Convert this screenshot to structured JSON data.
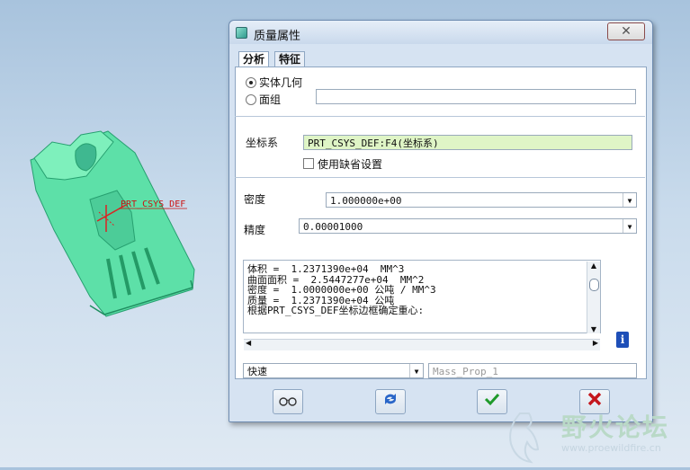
{
  "window": {
    "title": "质量属性",
    "close_symbol": "✕"
  },
  "tabs": [
    {
      "label": "分析"
    },
    {
      "label": "特征"
    }
  ],
  "model": {
    "csys_label": "PRT_CSYS_DEF"
  },
  "geometry": {
    "solid_label": "实体几何",
    "quilt_label": "面组",
    "quilt_value": "",
    "selected": "solid"
  },
  "csys": {
    "label": "坐标系",
    "value": "PRT_CSYS_DEF:F4(坐标系)",
    "use_default_label": "使用缺省设置",
    "use_default_checked": false
  },
  "density": {
    "label": "密度",
    "value": "1.000000e+00"
  },
  "accuracy": {
    "label": "精度",
    "value": "0.00001000"
  },
  "results": {
    "lines": [
      "体积 =  1.2371390e+04  MM^3",
      "曲面面积 =  2.5447277e+04  MM^2",
      "密度 =  1.0000000e+00 公吨 / MM^3",
      "质量 =  1.2371390e+04 公吨",
      "",
      "根据PRT_CSYS_DEF坐标边框确定重心:"
    ]
  },
  "mode": {
    "value": "快速"
  },
  "feature_name": {
    "placeholder": "Mass_Prop_1"
  },
  "buttons": {
    "preview_icon": "glasses-icon",
    "repeat_icon": "refresh-icon",
    "ok_icon": "check-icon",
    "cancel_icon": "x-icon"
  },
  "watermark": {
    "text": "野火论坛",
    "url": "www.proewildfire.cn"
  },
  "colors": {
    "model": "#5de0a8",
    "ok": "#1f9a2a",
    "cancel": "#c4161c",
    "csys_field": "#dff5c6"
  }
}
